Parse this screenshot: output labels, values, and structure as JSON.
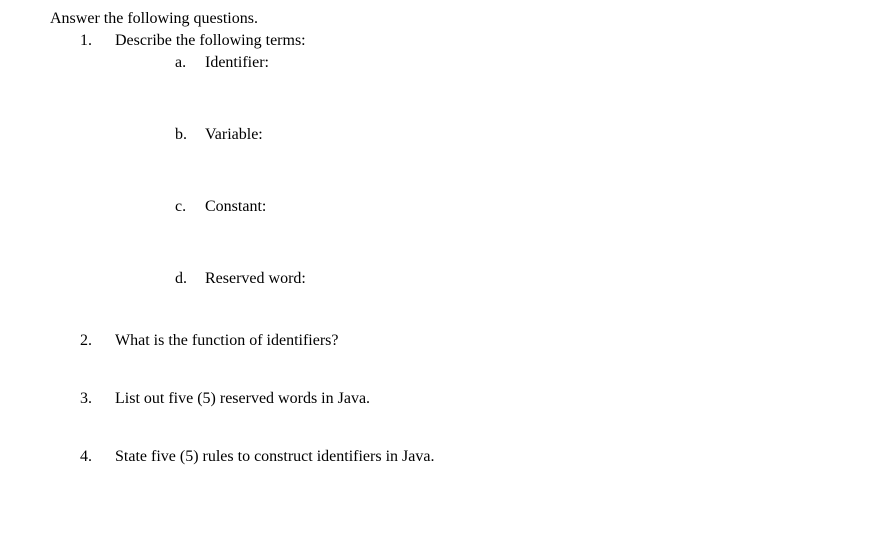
{
  "intro": "Answer the following questions.",
  "questions": [
    {
      "number": "1.",
      "text": "Describe the following terms:",
      "subitems": [
        {
          "letter": "a.",
          "text": "Identifier:"
        },
        {
          "letter": "b.",
          "text": "Variable:"
        },
        {
          "letter": "c.",
          "text": "Constant:"
        },
        {
          "letter": "d.",
          "text": "Reserved word:"
        }
      ]
    },
    {
      "number": "2.",
      "text": "What is the function of identifiers?"
    },
    {
      "number": "3.",
      "text": "List out five (5) reserved words in Java."
    },
    {
      "number": "4.",
      "text": "State five (5) rules to construct identifiers in Java."
    }
  ]
}
